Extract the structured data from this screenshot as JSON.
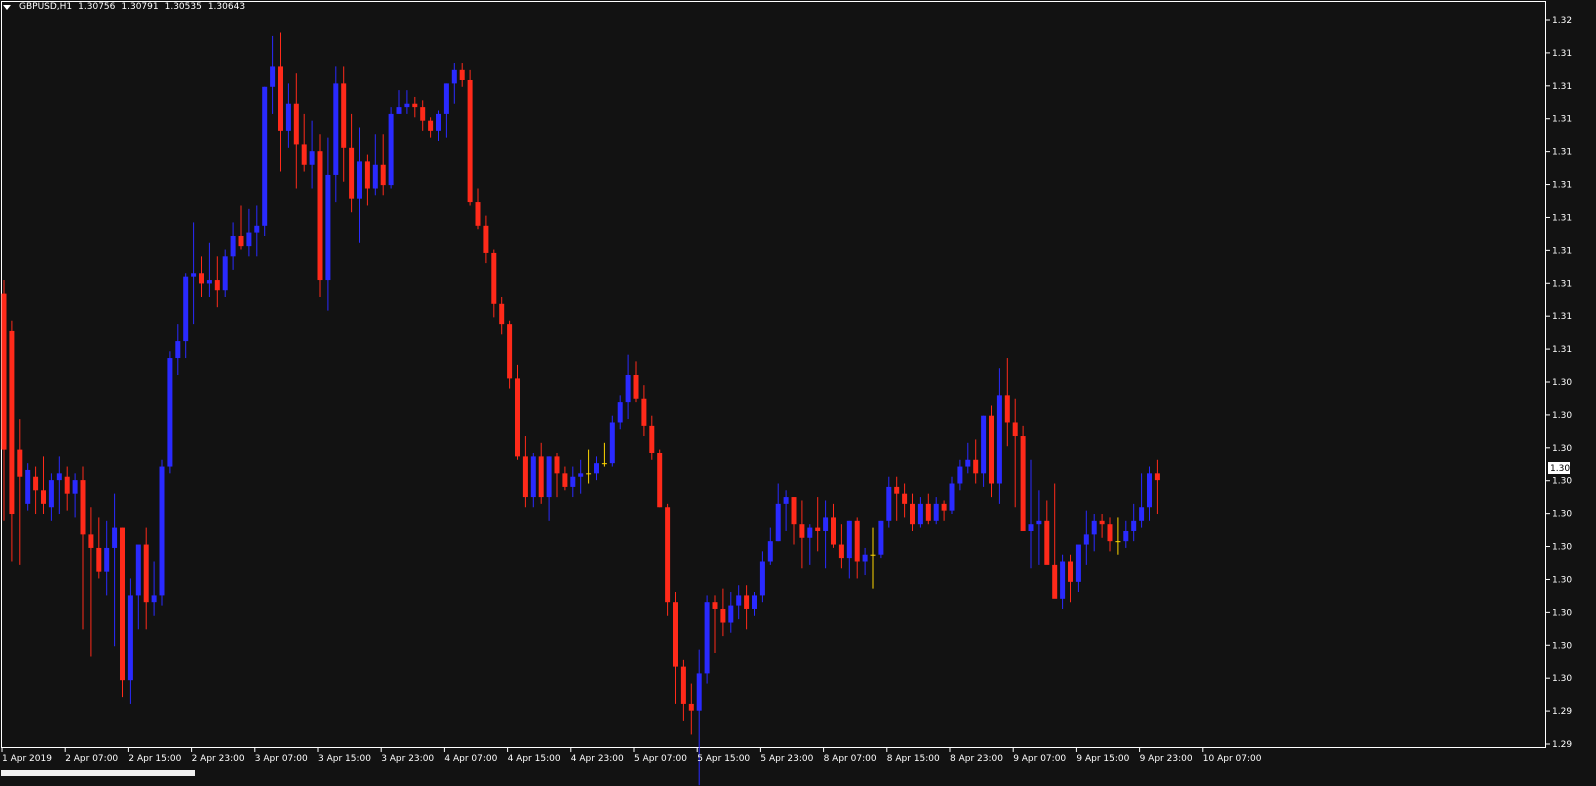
{
  "header": {
    "symbol": "GBPUSD,H1",
    "open": "1.30756",
    "high": "1.30791",
    "low": "1.30535",
    "close": "1.30643"
  },
  "current_price_label": "1.30",
  "colors": {
    "background": "#121212",
    "bull": "#2a2aff",
    "bear": "#ff2a1a",
    "doji": "#ffd700",
    "axis": "#ffffff",
    "price_box": "#ffffff"
  },
  "chart_data": {
    "type": "candlestick",
    "timeframe": "H1",
    "y_tick_labels": [
      "1.32",
      "1.31",
      "1.31",
      "1.31",
      "1.31",
      "1.31",
      "1.31",
      "1.31",
      "1.31",
      "1.31",
      "1.31",
      "1.30",
      "1.30",
      "1.30",
      "1.30",
      "1.30",
      "1.30",
      "1.30",
      "1.30",
      "1.30",
      "1.30",
      "1.29",
      "1.29"
    ],
    "x_tick_labels": [
      "1 Apr 2019",
      "2 Apr 07:00",
      "2 Apr 15:00",
      "2 Apr 23:00",
      "3 Apr 07:00",
      "3 Apr 15:00",
      "3 Apr 23:00",
      "4 Apr 07:00",
      "4 Apr 15:00",
      "4 Apr 23:00",
      "5 Apr 07:00",
      "5 Apr 15:00",
      "5 Apr 23:00",
      "8 Apr 07:00",
      "8 Apr 15:00",
      "8 Apr 23:00",
      "9 Apr 07:00",
      "9 Apr 15:00",
      "9 Apr 23:00",
      "10 Apr 07:00"
    ],
    "ylim": [
      1.2985,
      1.3205
    ],
    "candles": [
      [
        1.3119,
        1.3123,
        1.3052,
        1.3073
      ],
      [
        1.3108,
        1.3111,
        1.304,
        1.3054
      ],
      [
        1.3073,
        1.3082,
        1.3039,
        1.3065
      ],
      [
        1.3057,
        1.3069,
        1.3055,
        1.3067
      ],
      [
        1.3065,
        1.3068,
        1.3054,
        1.3061
      ],
      [
        1.3061,
        1.3071,
        1.3054,
        1.3057
      ],
      [
        1.3056,
        1.3066,
        1.3052,
        1.3064
      ],
      [
        1.3064,
        1.3071,
        1.3054,
        1.3066
      ],
      [
        1.3065,
        1.3068,
        1.3055,
        1.306
      ],
      [
        1.306,
        1.3066,
        1.3053,
        1.3064
      ],
      [
        1.3064,
        1.3068,
        1.302,
        1.3048
      ],
      [
        1.3048,
        1.3056,
        1.3012,
        1.3044
      ],
      [
        1.3044,
        1.3053,
        1.3035,
        1.3037
      ],
      [
        1.3037,
        1.3052,
        1.303,
        1.3044
      ],
      [
        1.3044,
        1.306,
        1.3015,
        1.305
      ],
      [
        1.305,
        1.305,
        1.3,
        1.3005
      ],
      [
        1.3005,
        1.3035,
        1.2998,
        1.303
      ],
      [
        1.303,
        1.304,
        1.302,
        1.3045
      ],
      [
        1.3045,
        1.305,
        1.302,
        1.3028
      ],
      [
        1.3028,
        1.304,
        1.3024,
        1.303
      ],
      [
        1.303,
        1.307,
        1.3027,
        1.3068
      ],
      [
        1.3068,
        1.3102,
        1.3066,
        1.31
      ],
      [
        1.31,
        1.311,
        1.3095,
        1.3105
      ],
      [
        1.3105,
        1.3125,
        1.31,
        1.3124
      ],
      [
        1.3124,
        1.314,
        1.311,
        1.3125
      ],
      [
        1.3125,
        1.313,
        1.3118,
        1.3122
      ],
      [
        1.3122,
        1.3134,
        1.3118,
        1.3123
      ],
      [
        1.3123,
        1.313,
        1.3115,
        1.312
      ],
      [
        1.312,
        1.3132,
        1.3118,
        1.313
      ],
      [
        1.313,
        1.314,
        1.3126,
        1.3136
      ],
      [
        1.3136,
        1.3145,
        1.3132,
        1.3133
      ],
      [
        1.3133,
        1.3144,
        1.313,
        1.3137
      ],
      [
        1.3137,
        1.3145,
        1.313,
        1.3139
      ],
      [
        1.3139,
        1.318,
        1.3136,
        1.318
      ],
      [
        1.318,
        1.3195,
        1.3172,
        1.3186
      ],
      [
        1.3186,
        1.3196,
        1.3155,
        1.3167
      ],
      [
        1.3167,
        1.3181,
        1.3162,
        1.3175
      ],
      [
        1.3175,
        1.3184,
        1.315,
        1.3163
      ],
      [
        1.3163,
        1.3172,
        1.3155,
        1.3157
      ],
      [
        1.3157,
        1.317,
        1.315,
        1.3161
      ],
      [
        1.3161,
        1.3166,
        1.3118,
        1.3123
      ],
      [
        1.3123,
        1.3165,
        1.3114,
        1.3154
      ],
      [
        1.3154,
        1.3186,
        1.3146,
        1.3181
      ],
      [
        1.3181,
        1.3186,
        1.3152,
        1.3162
      ],
      [
        1.3162,
        1.3172,
        1.3143,
        1.3147
      ],
      [
        1.3147,
        1.3168,
        1.3134,
        1.3158
      ],
      [
        1.3158,
        1.316,
        1.3145,
        1.315
      ],
      [
        1.315,
        1.3166,
        1.3148,
        1.3157
      ],
      [
        1.3157,
        1.3166,
        1.3148,
        1.3151
      ],
      [
        1.3151,
        1.3174,
        1.315,
        1.3172
      ],
      [
        1.3172,
        1.3179,
        1.3172,
        1.3174
      ],
      [
        1.3174,
        1.3179,
        1.3172,
        1.3175
      ],
      [
        1.3175,
        1.3177,
        1.3171,
        1.3174
      ],
      [
        1.3174,
        1.3176,
        1.3167,
        1.317
      ],
      [
        1.317,
        1.3171,
        1.3165,
        1.3167
      ],
      [
        1.3167,
        1.3173,
        1.3164,
        1.3172
      ],
      [
        1.3172,
        1.3181,
        1.3165,
        1.3181
      ],
      [
        1.3181,
        1.3187,
        1.3175,
        1.3185
      ],
      [
        1.3185,
        1.3187,
        1.318,
        1.3182
      ],
      [
        1.3182,
        1.3185,
        1.3145,
        1.3146
      ],
      [
        1.3146,
        1.315,
        1.3138,
        1.3139
      ],
      [
        1.3139,
        1.3142,
        1.3128,
        1.3131
      ],
      [
        1.3131,
        1.3132,
        1.3112,
        1.3116
      ],
      [
        1.3116,
        1.3118,
        1.3107,
        1.311
      ],
      [
        1.311,
        1.3111,
        1.3091,
        1.3094
      ],
      [
        1.3094,
        1.3098,
        1.307,
        1.3071
      ],
      [
        1.3071,
        1.3077,
        1.3056,
        1.3059
      ],
      [
        1.3059,
        1.3072,
        1.3056,
        1.3071
      ],
      [
        1.3071,
        1.3075,
        1.3057,
        1.3059
      ],
      [
        1.3059,
        1.3071,
        1.3052,
        1.3071
      ],
      [
        1.3071,
        1.3072,
        1.3059,
        1.3066
      ],
      [
        1.3066,
        1.3068,
        1.3061,
        1.3062
      ],
      [
        1.3062,
        1.3068,
        1.3059,
        1.3065
      ],
      [
        1.3065,
        1.307,
        1.306,
        1.3066
      ],
      [
        1.3066,
        1.3073,
        1.3063,
        1.3066
      ],
      [
        1.3066,
        1.3071,
        1.3064,
        1.3069
      ],
      [
        1.3069,
        1.3075,
        1.3068,
        1.3069
      ],
      [
        1.3069,
        1.3083,
        1.3068,
        1.3081
      ],
      [
        1.3081,
        1.3089,
        1.3079,
        1.3087
      ],
      [
        1.3087,
        1.3101,
        1.3082,
        1.3095
      ],
      [
        1.3095,
        1.3099,
        1.3087,
        1.3088
      ],
      [
        1.3088,
        1.3092,
        1.3077,
        1.308
      ],
      [
        1.308,
        1.3083,
        1.307,
        1.3072
      ],
      [
        1.3072,
        1.3073,
        1.3056,
        1.3056
      ],
      [
        1.3056,
        1.3057,
        1.3024,
        1.3028
      ],
      [
        1.3028,
        1.3031,
        1.2998,
        1.3009
      ],
      [
        1.3009,
        1.3011,
        1.2993,
        1.2998
      ],
      [
        1.2998,
        1.3004,
        1.2989,
        1.2996
      ],
      [
        1.2996,
        1.3014,
        1.2974,
        1.3007
      ],
      [
        1.3007,
        1.303,
        1.3004,
        1.3028
      ],
      [
        1.3028,
        1.303,
        1.3013,
        1.3026
      ],
      [
        1.3026,
        1.3032,
        1.3018,
        1.3022
      ],
      [
        1.3022,
        1.3031,
        1.3019,
        1.3027
      ],
      [
        1.3027,
        1.3033,
        1.3023,
        1.303
      ],
      [
        1.303,
        1.3033,
        1.302,
        1.3026
      ],
      [
        1.3026,
        1.3031,
        1.3024,
        1.303
      ],
      [
        1.303,
        1.3043,
        1.3028,
        1.304
      ],
      [
        1.304,
        1.305,
        1.3039,
        1.3046
      ],
      [
        1.3046,
        1.3063,
        1.3046,
        1.3057
      ],
      [
        1.3057,
        1.3061,
        1.3049,
        1.3059
      ],
      [
        1.3059,
        1.3059,
        1.3045,
        1.3051
      ],
      [
        1.3051,
        1.3058,
        1.3038,
        1.3047
      ],
      [
        1.3047,
        1.3051,
        1.3039,
        1.305
      ],
      [
        1.305,
        1.3059,
        1.3043,
        1.3049
      ],
      [
        1.3049,
        1.3058,
        1.3038,
        1.3053
      ],
      [
        1.3053,
        1.3057,
        1.3044,
        1.3045
      ],
      [
        1.3045,
        1.3051,
        1.3038,
        1.3041
      ],
      [
        1.3041,
        1.3052,
        1.3035,
        1.3052
      ],
      [
        1.3052,
        1.3053,
        1.3035,
        1.304
      ],
      [
        1.304,
        1.3044,
        1.3036,
        1.3042
      ],
      [
        1.3042,
        1.305,
        1.3032,
        1.3042
      ],
      [
        1.3042,
        1.3052,
        1.3041,
        1.3052
      ],
      [
        1.3052,
        1.3065,
        1.305,
        1.3062
      ],
      [
        1.3062,
        1.3065,
        1.3052,
        1.306
      ],
      [
        1.306,
        1.3063,
        1.3053,
        1.3057
      ],
      [
        1.3057,
        1.306,
        1.3049,
        1.3051
      ],
      [
        1.3051,
        1.3059,
        1.305,
        1.3057
      ],
      [
        1.3057,
        1.306,
        1.3051,
        1.3052
      ],
      [
        1.3052,
        1.3059,
        1.3051,
        1.3057
      ],
      [
        1.3057,
        1.3058,
        1.3052,
        1.3055
      ],
      [
        1.3055,
        1.3065,
        1.3054,
        1.3063
      ],
      [
        1.3063,
        1.307,
        1.3061,
        1.3068
      ],
      [
        1.3068,
        1.3075,
        1.3066,
        1.307
      ],
      [
        1.307,
        1.3076,
        1.3063,
        1.3066
      ],
      [
        1.3066,
        1.3083,
        1.3062,
        1.3083
      ],
      [
        1.3083,
        1.3086,
        1.3059,
        1.3063
      ],
      [
        1.3063,
        1.3097,
        1.3057,
        1.3089
      ],
      [
        1.3089,
        1.31,
        1.3074,
        1.3081
      ],
      [
        1.3081,
        1.3088,
        1.3056,
        1.3077
      ],
      [
        1.3077,
        1.308,
        1.3049,
        1.3049
      ],
      [
        1.3049,
        1.307,
        1.3038,
        1.3051
      ],
      [
        1.3051,
        1.3061,
        1.3039,
        1.3052
      ],
      [
        1.3052,
        1.3058,
        1.3042,
        1.3039
      ],
      [
        1.3039,
        1.3063,
        1.3034,
        1.3029
      ],
      [
        1.3029,
        1.3042,
        1.3026,
        1.304
      ],
      [
        1.304,
        1.3042,
        1.3028,
        1.3034
      ],
      [
        1.3034,
        1.304,
        1.3031,
        1.3045
      ],
      [
        1.3045,
        1.3055,
        1.3039,
        1.3048
      ],
      [
        1.3048,
        1.3054,
        1.3043,
        1.3052
      ],
      [
        1.3052,
        1.3054,
        1.3047,
        1.3051
      ],
      [
        1.3051,
        1.3053,
        1.3043,
        1.3046
      ],
      [
        1.3046,
        1.3053,
        1.3042,
        1.3046
      ],
      [
        1.3046,
        1.3052,
        1.3044,
        1.3049
      ],
      [
        1.3049,
        1.3057,
        1.3046,
        1.3052
      ],
      [
        1.3052,
        1.3066,
        1.305,
        1.3056
      ],
      [
        1.3056,
        1.3068,
        1.3052,
        1.3066
      ],
      [
        1.3066,
        1.307,
        1.3054,
        1.3064
      ]
    ]
  }
}
